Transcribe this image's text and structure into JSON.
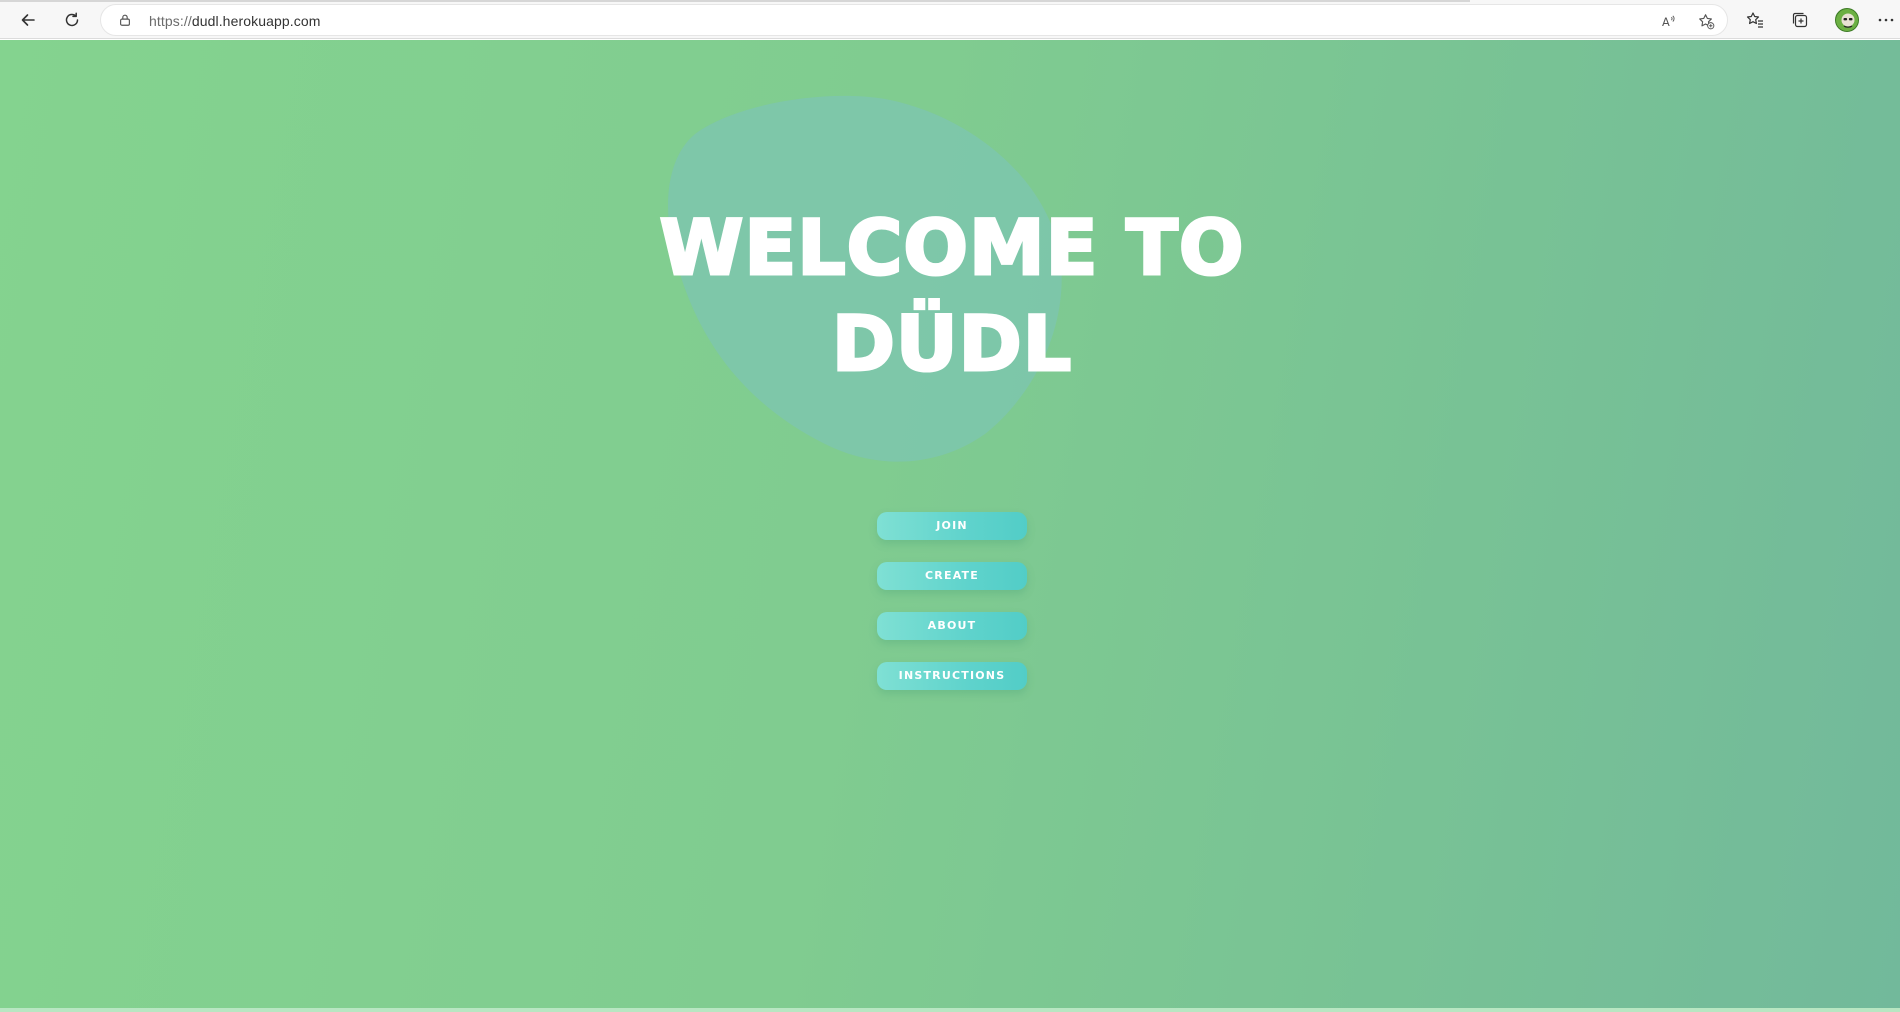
{
  "browser": {
    "url_protocol": "https://",
    "url_host": "dudl.herokuapp.com",
    "icons": {
      "back": "back-arrow-icon",
      "reload": "reload-icon",
      "lock": "lock-icon",
      "read_aloud": "read-aloud-icon",
      "add_favorite": "add-favorite-icon",
      "favorites": "favorites-icon",
      "collections": "collections-icon",
      "profile": "profile-avatar",
      "menu": "more-icon"
    }
  },
  "page": {
    "title_line1": "WELCOME TO",
    "title_line2": "DÜDL",
    "menu": [
      {
        "label": "JOIN"
      },
      {
        "label": "CREATE"
      },
      {
        "label": "ABOUT"
      },
      {
        "label": "INSTRUCTIONS"
      }
    ],
    "colors": {
      "background_start": "#84d38f",
      "background_end": "#72b99b",
      "blob": "#7dc6ab",
      "button_start": "#7fe0d4",
      "button_end": "#52cdc7",
      "text": "#ffffff"
    }
  }
}
